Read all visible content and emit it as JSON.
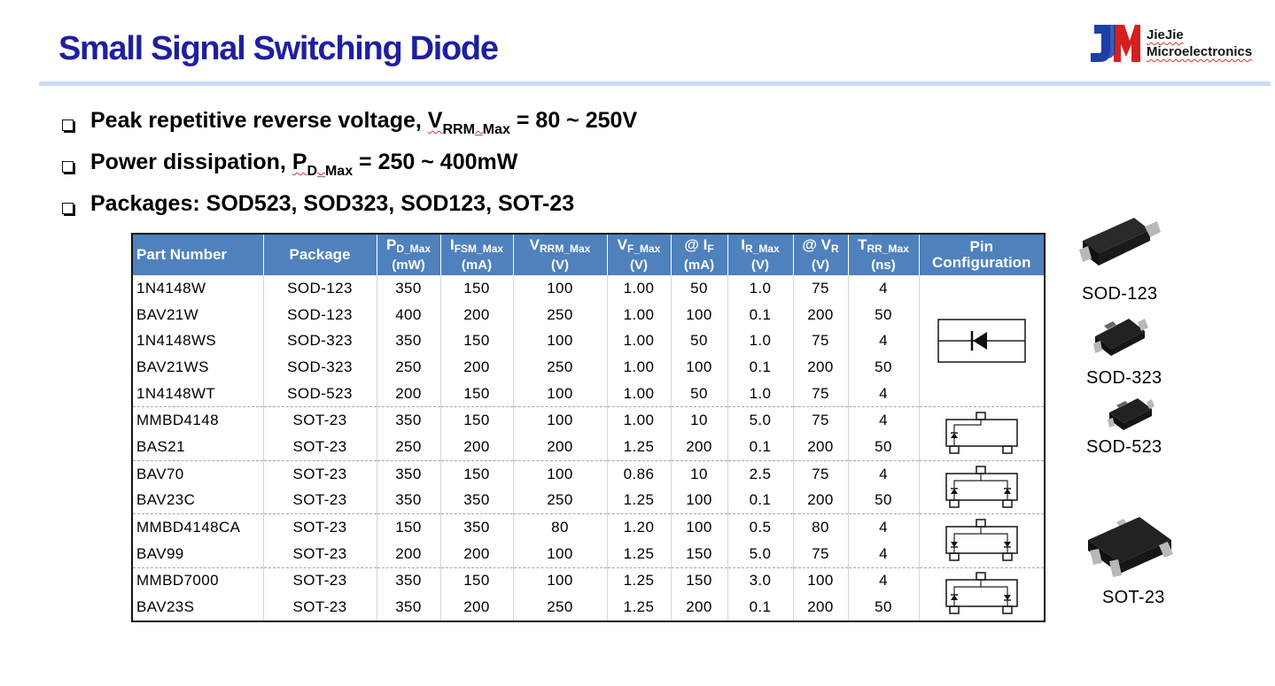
{
  "page": {
    "title": "Small Signal Switching Diode",
    "brand": {
      "line1": "JieJie",
      "line2": "Microelectronics"
    }
  },
  "bullets": [
    {
      "before": "Peak repetitive reverse voltage, ",
      "sym": "V",
      "sub": "RRM_Max",
      "after": " = 80 ~ 250V"
    },
    {
      "before": "Power dissipation, ",
      "sym": "P",
      "sub": "D_Max",
      "after": " = 250 ~ 400mW"
    },
    {
      "before": "Packages: SOD523, SOD323, SOD123, SOT-23",
      "sym": "",
      "sub": "",
      "after": ""
    }
  ],
  "table": {
    "headers": {
      "part": "Part Number",
      "package": "Package",
      "pd": {
        "sym": "P",
        "sub": "D_Max",
        "unit": "(mW)"
      },
      "ifsm": {
        "sym": "I",
        "sub": "FSM_Max",
        "unit": "(mA)"
      },
      "vrrm": {
        "sym": "V",
        "sub": "RRM_Max",
        "unit": "(V)"
      },
      "vf": {
        "sym": "V",
        "sub": "F_Max",
        "unit": "(V)"
      },
      "atif": {
        "sym": "@ I",
        "sub": "F",
        "unit": "(mA)"
      },
      "ir": {
        "sym": "I",
        "sub": "R_Max",
        "unit": "(V)"
      },
      "atvr": {
        "sym": "@ V",
        "sub": "R",
        "unit": "(V)"
      },
      "trr": {
        "sym": "T",
        "sub": "RR_Max",
        "unit": "(ns)"
      },
      "pin": {
        "line1": "Pin",
        "line2": "Configuration"
      }
    },
    "rows": [
      [
        "1N4148W",
        "SOD-123",
        "350",
        "150",
        "100",
        "1.00",
        "50",
        "1.0",
        "75",
        "4"
      ],
      [
        "BAV21W",
        "SOD-123",
        "400",
        "200",
        "250",
        "1.00",
        "100",
        "0.1",
        "200",
        "50"
      ],
      [
        "1N4148WS",
        "SOD-323",
        "350",
        "150",
        "100",
        "1.00",
        "50",
        "1.0",
        "75",
        "4"
      ],
      [
        "BAV21WS",
        "SOD-323",
        "250",
        "200",
        "250",
        "1.00",
        "100",
        "0.1",
        "200",
        "50"
      ],
      [
        "1N4148WT",
        "SOD-523",
        "200",
        "150",
        "100",
        "1.00",
        "50",
        "1.0",
        "75",
        "4"
      ],
      [
        "MMBD4148",
        "SOT-23",
        "350",
        "150",
        "100",
        "1.00",
        "10",
        "5.0",
        "75",
        "4"
      ],
      [
        "BAS21",
        "SOT-23",
        "250",
        "200",
        "200",
        "1.25",
        "200",
        "0.1",
        "200",
        "50"
      ],
      [
        "BAV70",
        "SOT-23",
        "350",
        "150",
        "100",
        "0.86",
        "10",
        "2.5",
        "75",
        "4"
      ],
      [
        "BAV23C",
        "SOT-23",
        "350",
        "350",
        "250",
        "1.25",
        "100",
        "0.1",
        "200",
        "50"
      ],
      [
        "MMBD4148CA",
        "SOT-23",
        "150",
        "350",
        "80",
        "1.20",
        "100",
        "0.5",
        "80",
        "4"
      ],
      [
        "BAV99",
        "SOT-23",
        "200",
        "200",
        "100",
        "1.25",
        "150",
        "5.0",
        "75",
        "4"
      ],
      [
        "MMBD7000",
        "SOT-23",
        "350",
        "150",
        "100",
        "1.25",
        "150",
        "3.0",
        "100",
        "4"
      ],
      [
        "BAV23S",
        "SOT-23",
        "350",
        "200",
        "250",
        "1.25",
        "200",
        "0.1",
        "200",
        "50"
      ]
    ],
    "pin_icons": [
      "single-diode-icon",
      "sot23-single-diode-icon",
      "sot23-common-cathode-icon",
      "sot23-common-anode-icon",
      "sot23-series-pair-icon"
    ]
  },
  "packages": [
    {
      "label": "SOD-123",
      "icon": "sod123-package-icon"
    },
    {
      "label": "SOD-323",
      "icon": "sod323-package-icon"
    },
    {
      "label": "SOD-523",
      "icon": "sod523-package-icon"
    },
    {
      "label": "SOT-23",
      "icon": "sot23-package-icon"
    }
  ],
  "colors": {
    "title": "#1f1fa0",
    "header_bg": "#4f81bd",
    "rule": "#c9dcf2",
    "logo_blue": "#1d3fa6",
    "logo_red": "#d42020"
  }
}
